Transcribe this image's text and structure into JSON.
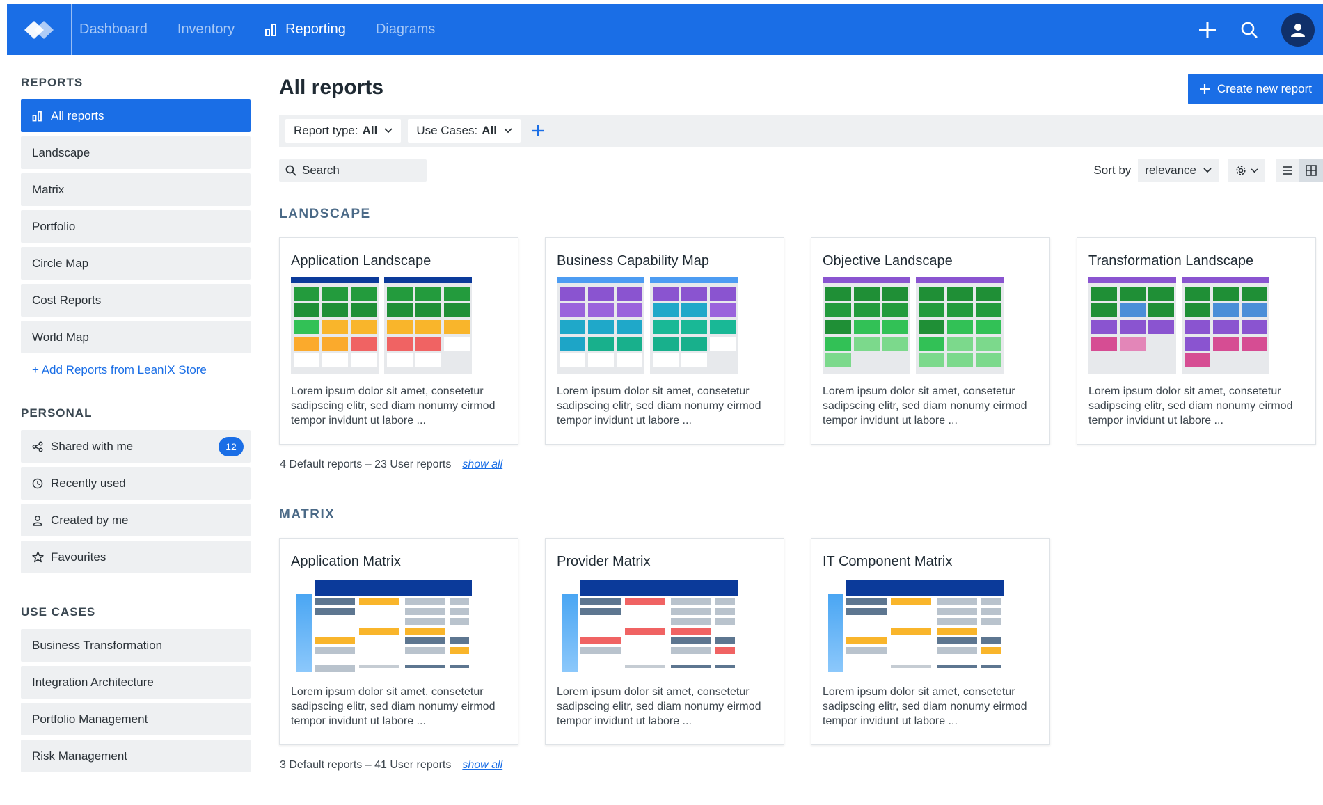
{
  "header": {
    "nav": [
      {
        "label": "Dashboard",
        "active": false
      },
      {
        "label": "Inventory",
        "active": false
      },
      {
        "label": "Reporting",
        "active": true
      },
      {
        "label": "Diagrams",
        "active": false
      }
    ],
    "icons": [
      "leanix-logo-icon",
      "bar-chart-icon",
      "plus-icon",
      "search-icon",
      "user-icon"
    ]
  },
  "sidebar": {
    "reports_heading": "REPORTS",
    "reports": [
      "All reports",
      "Landscape",
      "Matrix",
      "Portfolio",
      "Circle Map",
      "Cost Reports",
      "World Map"
    ],
    "add_link": "+ Add Reports from LeanIX Store",
    "personal_heading": "PERSONAL",
    "personal": [
      {
        "label": "Shared with me",
        "icon": "share-icon",
        "badge": "12"
      },
      {
        "label": "Recently used",
        "icon": "clock-icon"
      },
      {
        "label": "Created by me",
        "icon": "person-icon"
      },
      {
        "label": "Favourites",
        "icon": "star-icon"
      }
    ],
    "usecases_heading": "USE CASES",
    "usecases": [
      "Business Transformation",
      "Integration Architecture",
      "Portfolio Management",
      "Risk Management"
    ]
  },
  "main": {
    "title": "All reports",
    "create_button": "Create new report",
    "filters": [
      {
        "label": "Report type:",
        "value": "All"
      },
      {
        "label": "Use Cases:",
        "value": "All"
      }
    ],
    "search_placeholder": "Search",
    "sort_label": "Sort by",
    "sort_value": "relevance",
    "sections": [
      {
        "title": "LANDSCAPE",
        "cards": [
          {
            "title": "Application Landscape",
            "desc": "Lorem ipsum dolor sit amet, consetetur sadipscing elitr, sed diam nonumy eirmod tempor invidunt ut labore ..."
          },
          {
            "title": "Business Capability Map",
            "desc": "Lorem ipsum dolor sit amet, consetetur sadipscing elitr, sed diam nonumy eirmod tempor invidunt ut labore ..."
          },
          {
            "title": "Objective Landscape",
            "desc": "Lorem ipsum dolor sit amet, consetetur sadipscing elitr, sed diam nonumy eirmod tempor invidunt ut labore ..."
          },
          {
            "title": "Transformation Landscape",
            "desc": "Lorem ipsum dolor sit amet, consetetur sadipscing elitr, sed diam nonumy eirmod tempor invidunt ut labore ..."
          }
        ],
        "meta": "4 Default reports – 23 User reports",
        "show_all": "show all"
      },
      {
        "title": "MATRIX",
        "cards": [
          {
            "title": "Application Matrix",
            "desc": "Lorem ipsum dolor sit amet, consetetur sadipscing elitr, sed diam nonumy eirmod tempor invidunt ut labore ..."
          },
          {
            "title": "Provider Matrix",
            "desc": "Lorem ipsum dolor sit amet, consetetur sadipscing elitr, sed diam nonumy eirmod tempor invidunt ut labore ..."
          },
          {
            "title": "IT Component Matrix",
            "desc": "Lorem ipsum dolor sit amet, consetetur sadipscing elitr, sed diam nonumy eirmod tempor invidunt ut labore ..."
          }
        ],
        "meta": "3 Default reports – 41 User reports",
        "show_all": "show all"
      }
    ]
  },
  "colors": {
    "brand_blue": "#1a6ee6",
    "navy": "#0b3a9a",
    "green": "#2fb34a",
    "yellow": "#f9b52b",
    "red": "#f06363",
    "purple": "#8a54d0",
    "teal": "#1fa8c9",
    "pink": "#d64d93"
  }
}
